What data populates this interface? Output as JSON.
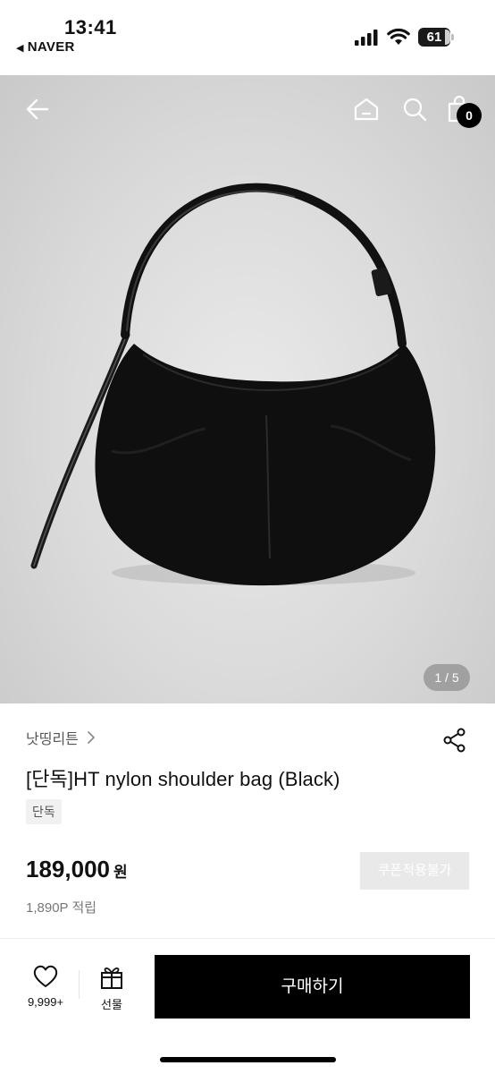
{
  "status_bar": {
    "time": "13:41",
    "back_app_label": "NAVER",
    "battery_level": "61"
  },
  "header": {
    "back_icon": "arrow-left-icon",
    "home_icon": "home-icon",
    "search_icon": "search-icon",
    "cart_icon": "shopping-bag-icon",
    "cart_count": "0"
  },
  "gallery": {
    "pager": "1 / 5"
  },
  "product": {
    "brand": "낫띵리튼",
    "title": "[단독]HT nylon shoulder bag (Black)",
    "tag": "단독",
    "price": "189,000",
    "currency": "원",
    "coupon_label": "쿠폰적용불가",
    "points": "1,890P 적립"
  },
  "bottom_bar": {
    "like_count": "9,999+",
    "gift_label": "선물",
    "buy_label": "구매하기"
  },
  "colors": {
    "buy_button": "#000000",
    "coupon_disabled": "#e9e9e9",
    "hero_background": "#dadada"
  }
}
